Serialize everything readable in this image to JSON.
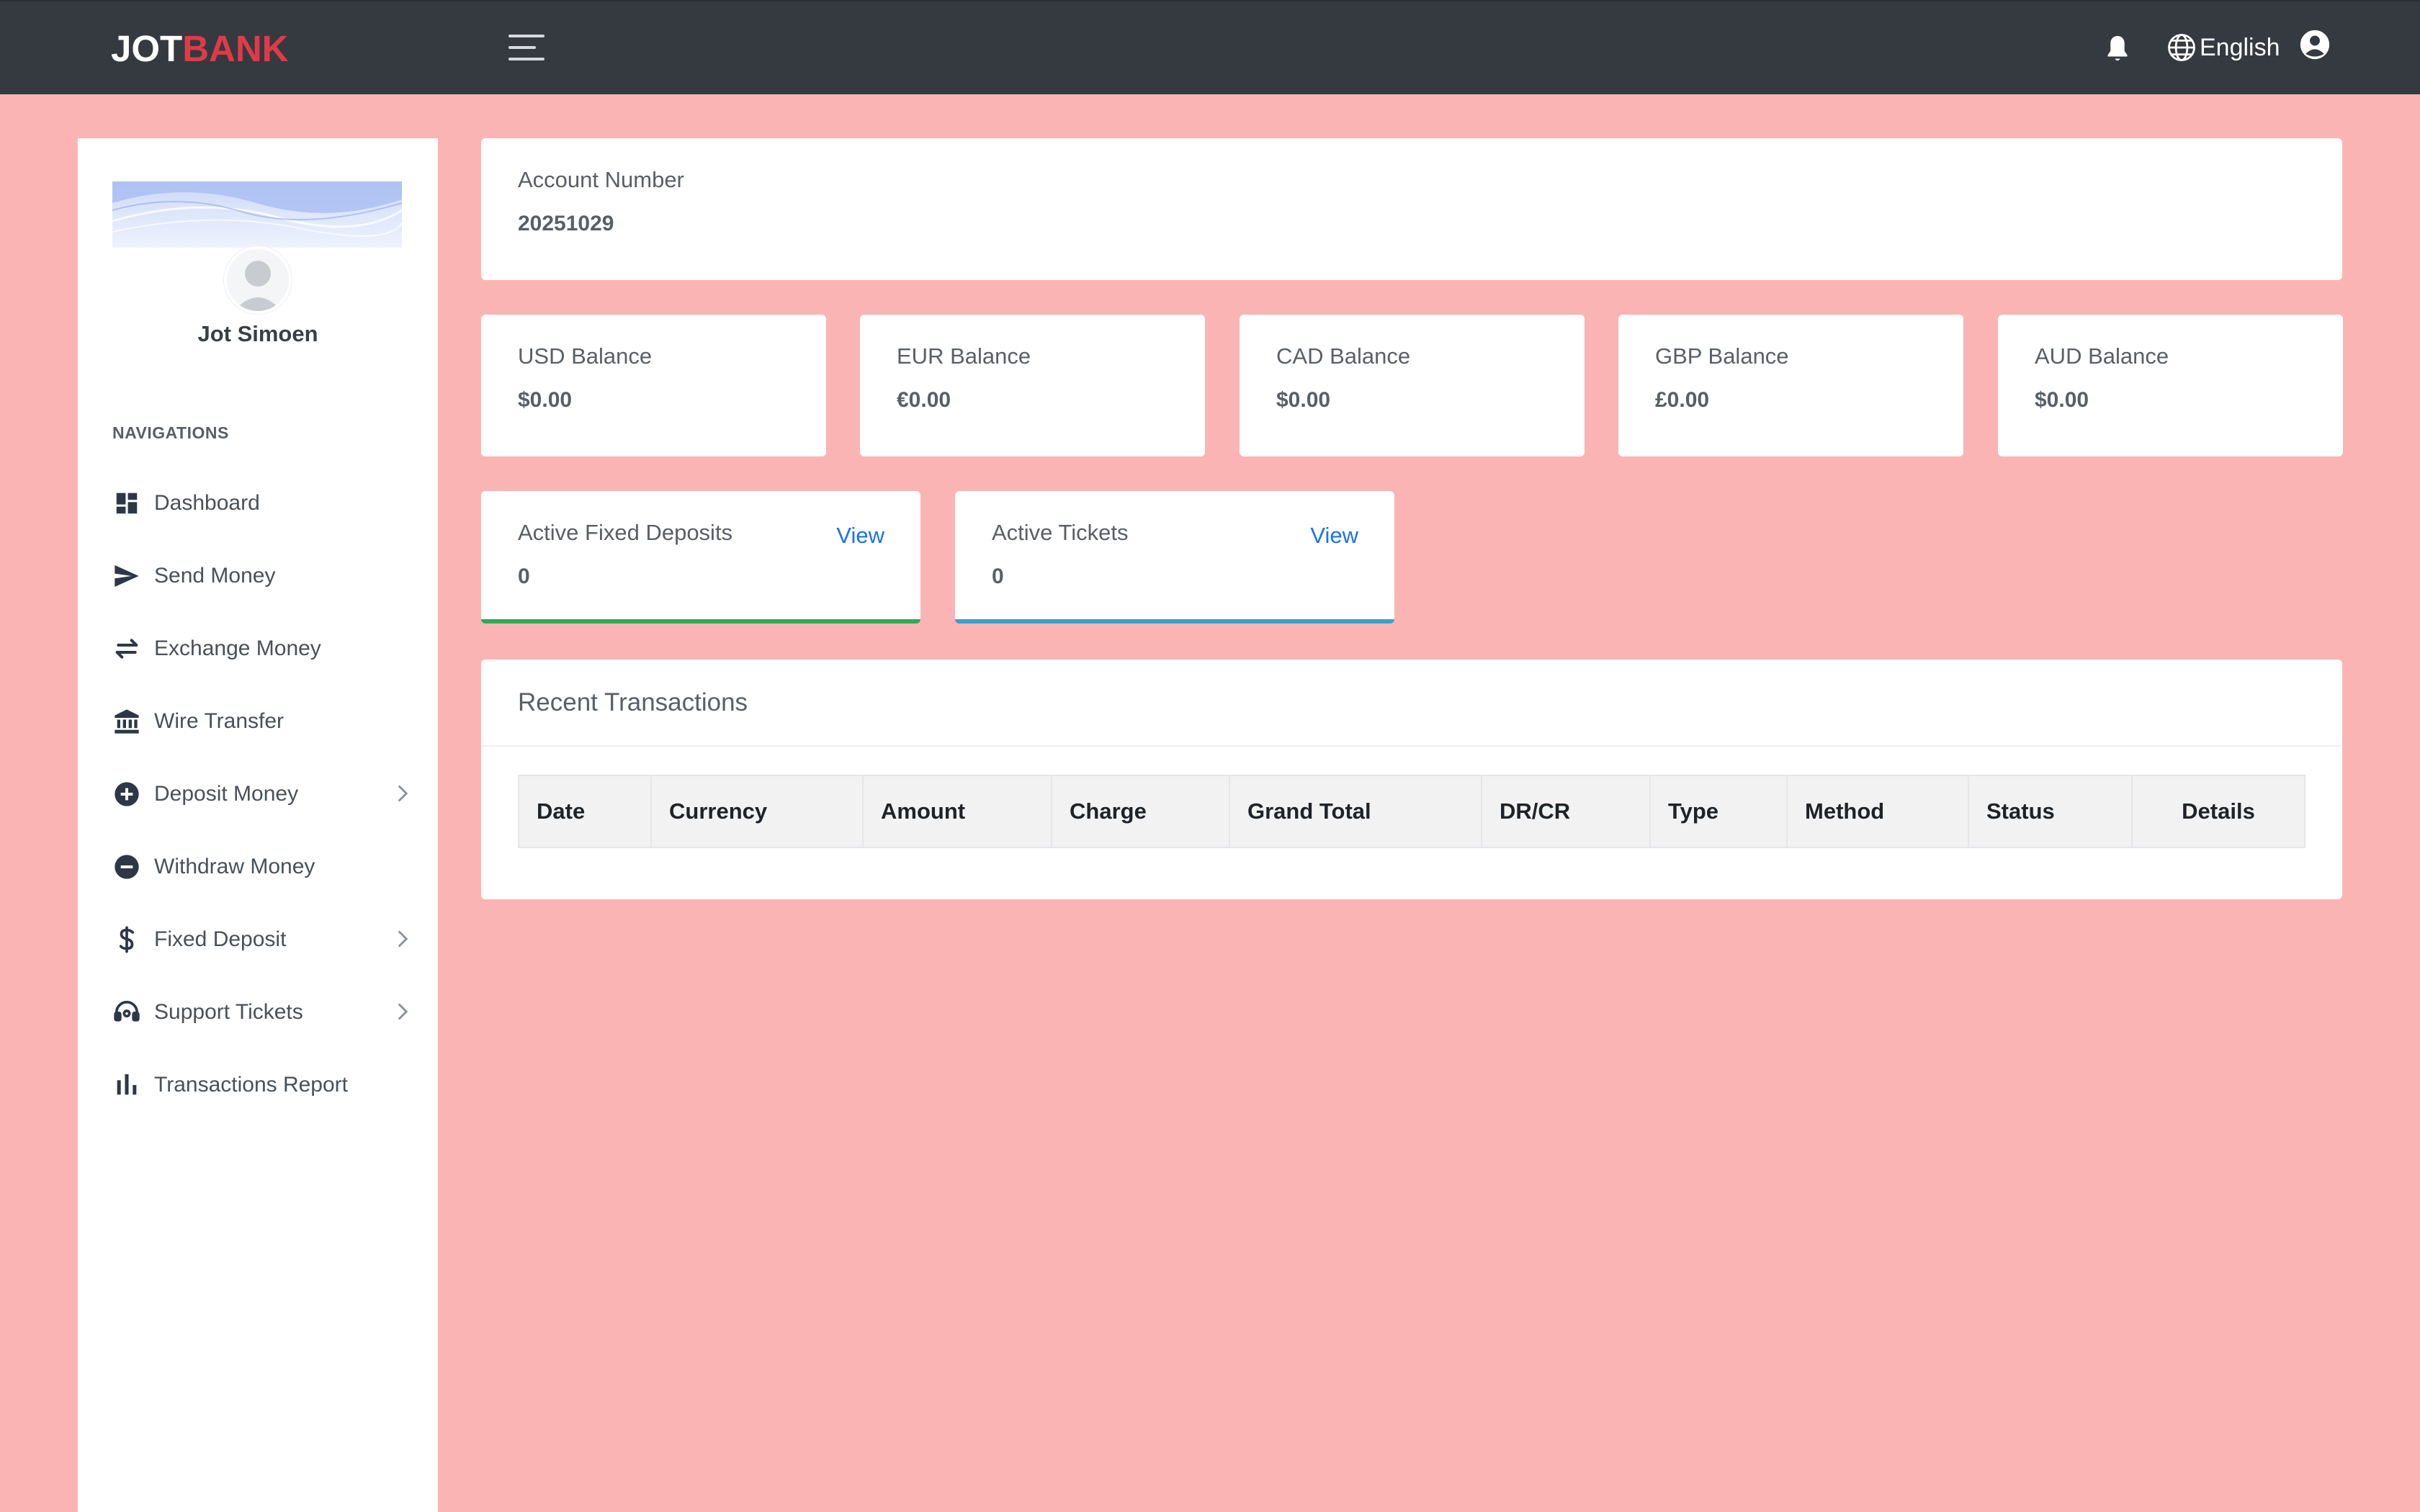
{
  "brand": {
    "part1": "JOT",
    "part2": "BANK",
    "accent": "#e03a48"
  },
  "topbar": {
    "language": "English",
    "icons": [
      "bell-icon",
      "globe-icon",
      "user-circle-icon",
      "hamburger-icon"
    ]
  },
  "profile": {
    "name": "Jot Simoen"
  },
  "sidebar": {
    "heading": "NAVIGATIONS",
    "items": [
      {
        "label": "Dashboard",
        "icon": "dashboard-icon",
        "has_submenu": false
      },
      {
        "label": "Send Money",
        "icon": "send-icon",
        "has_submenu": false
      },
      {
        "label": "Exchange Money",
        "icon": "exchange-icon",
        "has_submenu": false
      },
      {
        "label": "Wire Transfer",
        "icon": "bank-icon",
        "has_submenu": false
      },
      {
        "label": "Deposit Money",
        "icon": "plus-circle-icon",
        "has_submenu": true
      },
      {
        "label": "Withdraw Money",
        "icon": "minus-circle-icon",
        "has_submenu": false
      },
      {
        "label": "Fixed Deposit",
        "icon": "dollar-icon",
        "has_submenu": true
      },
      {
        "label": "Support Tickets",
        "icon": "headset-icon",
        "has_submenu": true
      },
      {
        "label": "Transactions Report",
        "icon": "bar-chart-icon",
        "has_submenu": false
      }
    ]
  },
  "account": {
    "label": "Account Number",
    "number": "20251029"
  },
  "balances": [
    {
      "label": "USD Balance",
      "value": "$0.00"
    },
    {
      "label": "EUR Balance",
      "value": "€0.00"
    },
    {
      "label": "CAD Balance",
      "value": "$0.00"
    },
    {
      "label": "GBP Balance",
      "value": "£0.00"
    },
    {
      "label": "AUD Balance",
      "value": "$0.00"
    }
  ],
  "stats": [
    {
      "label": "Active Fixed Deposits",
      "value": "0",
      "link": "View",
      "color": "#34a853"
    },
    {
      "label": "Active Tickets",
      "value": "0",
      "link": "View",
      "color": "#3aa0c8"
    }
  ],
  "transactions": {
    "title": "Recent Transactions",
    "columns": [
      "Date",
      "Currency",
      "Amount",
      "Charge",
      "Grand Total",
      "DR/CR",
      "Type",
      "Method",
      "Status",
      "Details"
    ],
    "rows": []
  }
}
